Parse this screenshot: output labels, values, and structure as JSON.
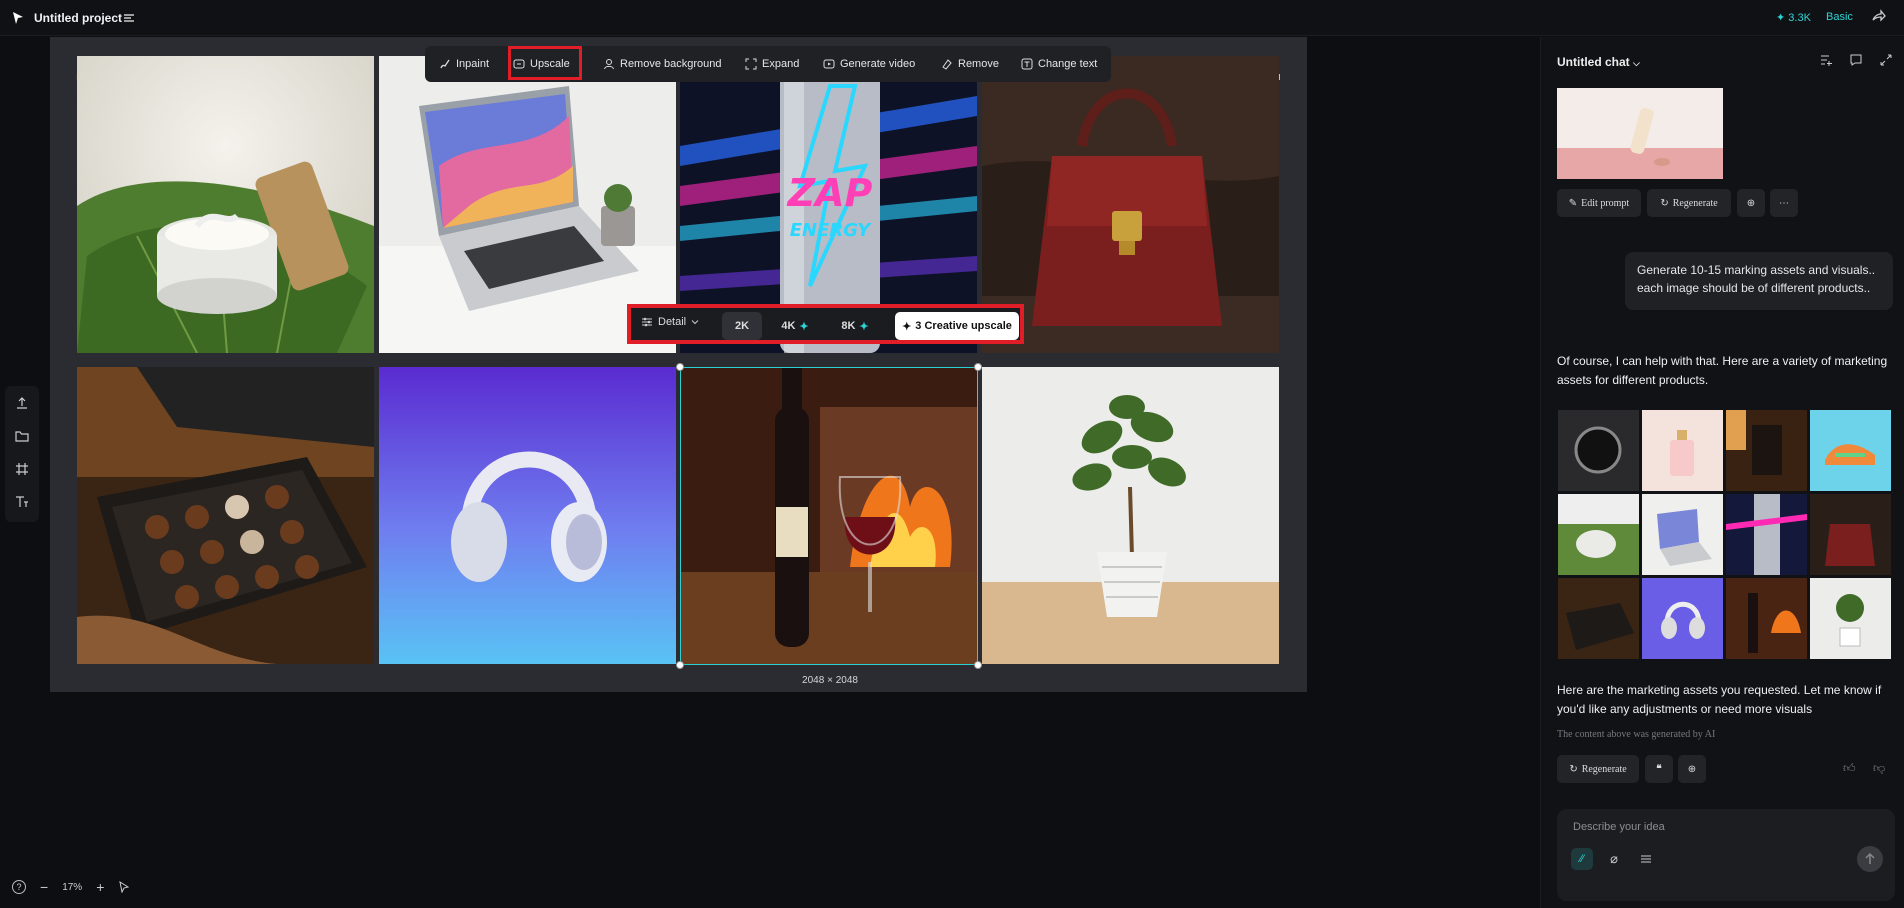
{
  "topbar": {
    "title": "Untitled project",
    "credits": "✦ 3.3K",
    "plan": "Basic"
  },
  "edit_toolbar": {
    "inpaint": "Inpaint",
    "upscale": "Upscale",
    "remove_background": "Remove background",
    "expand": "Expand",
    "generate_video": "Generate video",
    "remove": "Remove",
    "change_text": "Change text"
  },
  "upscale_bar": {
    "detail": "Detail",
    "opt_2k": "2K",
    "opt_4k": "4K",
    "opt_8k": "8K",
    "creative": "3 Creative upscale"
  },
  "selection": {
    "dimensions": "2048 × 2048"
  },
  "zoom": {
    "level": "17%"
  },
  "chat": {
    "title": "Untitled chat",
    "edit_prompt": "Edit prompt",
    "regenerate": "Regenerate",
    "user_message": "Generate 10-15 marking assets and visuals.. each image should be of different products..",
    "ai_intro": "Of course, I can help with that. Here are a variety of marketing assets for different products.",
    "ai_outro": "Here are the marketing assets you requested. Let me know if you'd like any adjustments or need more visuals",
    "disclaimer": "The content above was generated by AI",
    "regenerate2": "Regenerate",
    "composer_placeholder": "Describe your idea"
  },
  "accent_color": "#2dd4d4",
  "highlight_color": "#e11d27"
}
